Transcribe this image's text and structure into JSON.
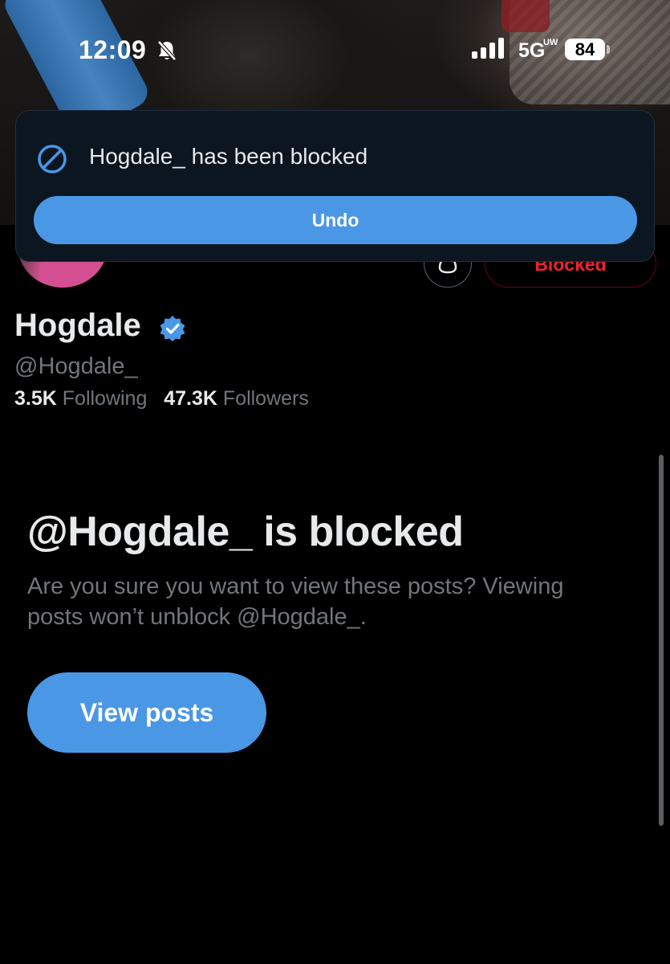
{
  "status_bar": {
    "time": "12:09",
    "network": "5G",
    "network_sub": "UW",
    "battery": "84"
  },
  "profile": {
    "name": "Hogdale",
    "handle": "@Hogdale_",
    "following_count": "3.5K",
    "following_label": "Following",
    "followers_count": "47.3K",
    "followers_label": "Followers",
    "blocked_button_label": "Blocked",
    "verified": true
  },
  "toast": {
    "message": "Hogdale_ has been blocked",
    "undo_label": "Undo",
    "icon": "block-icon"
  },
  "blocked_notice": {
    "title": "@Hogdale_ is blocked",
    "description": "Are you sure you want to view these posts? Viewing posts won’t unblock @Hogdale_.",
    "view_posts_label": "View posts"
  },
  "colors": {
    "accent": "#4a97e6",
    "background": "#000000",
    "danger": "#f4212e",
    "secondary_text": "#71767b",
    "toast_bg": "#0b1620"
  }
}
